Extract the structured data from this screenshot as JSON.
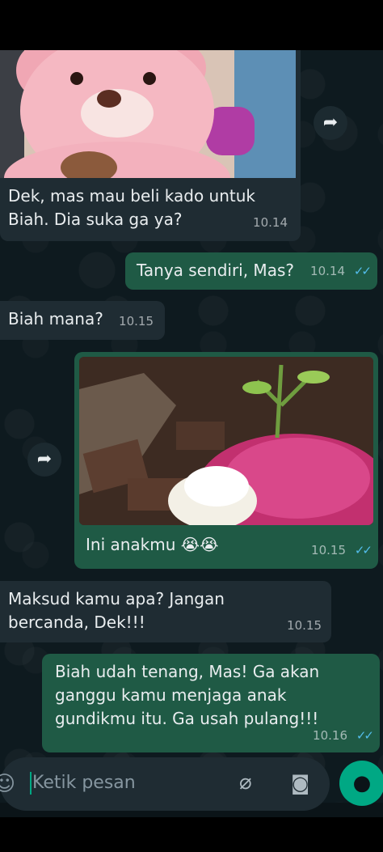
{
  "messages": [
    {
      "id": "b1",
      "direction": "in",
      "image": "teddy-bear",
      "text": "Dek, mas mau beli kado untuk Biah. Dia suka ga ya?",
      "time": "10.14"
    },
    {
      "id": "b2",
      "direction": "out",
      "text": "Tanya sendiri, Mas?",
      "time": "10.14",
      "status": "read"
    },
    {
      "id": "b3",
      "direction": "in",
      "text": "Biah mana?",
      "time": "10.15"
    },
    {
      "id": "b4",
      "direction": "out",
      "image": "flower-covered-grave",
      "text": "Ini anakmu 😭😭",
      "time": "10.15",
      "status": "read"
    },
    {
      "id": "b5",
      "direction": "in",
      "text": "Maksud kamu apa? Jangan bercanda, Dek!!!",
      "time": "10.15"
    },
    {
      "id": "b6",
      "direction": "out",
      "text": "Biah udah tenang, Mas! Ga akan ganggu kamu menjaga anak gundikmu itu. Ga usah pulang!!!",
      "time": "10.16",
      "status": "read"
    }
  ],
  "composer": {
    "placeholder": "Ketik pesan"
  },
  "icons": {
    "forward": "forward-icon",
    "emoji": "emoji-icon",
    "attach": "paperclip-icon",
    "camera": "camera-icon",
    "mic": "microphone-icon",
    "read": "double-check-icon"
  },
  "colors": {
    "incoming": "#1f2c33",
    "outgoing": "#1f5a45",
    "accent": "#00a884",
    "read_ticks": "#53bdeb"
  }
}
